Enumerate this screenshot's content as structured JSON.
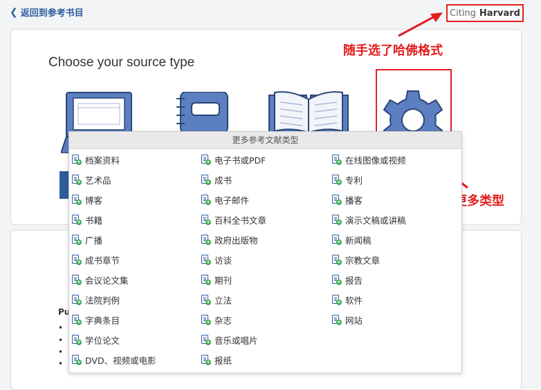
{
  "nav": {
    "back_label": "返回到参考书目"
  },
  "citing": {
    "prefix": "Citing",
    "style": "Harvard"
  },
  "main": {
    "choose_title": "Choose your source type"
  },
  "annotations": {
    "top": "随手选了哈佛格式",
    "bottom": "点击选择更多类型"
  },
  "dropdown": {
    "header": "更多参考文献类型",
    "col1": [
      "档案资料",
      "艺术品",
      "博客",
      "书籍",
      "广播",
      "成书章节",
      "会议论文集",
      "法院判例",
      "字典条目",
      "学位论文",
      "DVD、视频或电影"
    ],
    "col2": [
      "电子书或PDF",
      "成书",
      "电子邮件",
      "百科全书文章",
      "政府出版物",
      "访谈",
      "期刊",
      "立法",
      "杂志",
      "音乐或唱片",
      "报纸"
    ],
    "col3": [
      "在线图像或视频",
      "专利",
      "播客",
      "演示文稿或讲稿",
      "新闻稿",
      "宗教文章",
      "报告",
      "软件",
      "网站"
    ]
  },
  "left_fragment": "Pu",
  "colors": {
    "accent": "#2d5e9e",
    "annotation": "#e21e1e",
    "plus": "#3aa54a"
  }
}
